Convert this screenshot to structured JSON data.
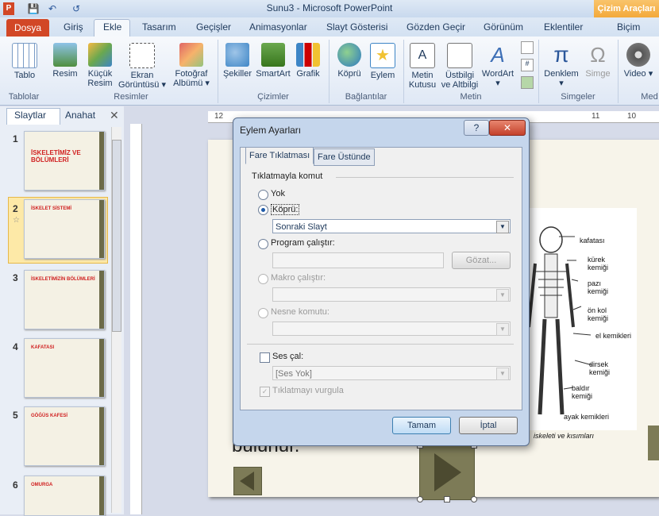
{
  "window": {
    "title": "Sunu3 - Microsoft PowerPoint",
    "contextual_title": "Çizim Araçları"
  },
  "qat": {
    "save_icon": "save-icon",
    "undo_icon": "undo-icon",
    "redo_icon": "redo-icon"
  },
  "tabs": [
    {
      "label": "Dosya"
    },
    {
      "label": "Giriş"
    },
    {
      "label": "Ekle"
    },
    {
      "label": "Tasarım"
    },
    {
      "label": "Geçişler"
    },
    {
      "label": "Animasyonlar"
    },
    {
      "label": "Slayt Gösterisi"
    },
    {
      "label": "Gözden Geçir"
    },
    {
      "label": "Görünüm"
    },
    {
      "label": "Eklentiler"
    },
    {
      "label": "Biçim"
    }
  ],
  "ribbon": {
    "tablo": "Tablo",
    "resim": "Resim",
    "kucuk_resim_1": "Küçük",
    "kucuk_resim_2": "Resim",
    "ekran_1": "Ekran",
    "ekran_2": "Görüntüsü",
    "foto_1": "Fotoğraf",
    "foto_2": "Albümü",
    "sekiller": "Şekiller",
    "smartart": "SmartArt",
    "grafik": "Grafik",
    "kopru": "Köprü",
    "eylem": "Eylem",
    "metin_1": "Metin",
    "metin_2": "Kutusu",
    "ustbilgi_1": "Üstbilgi",
    "ustbilgi_2": "ve Altbilgi",
    "wordart": "WordArt",
    "denklem": "Denklem",
    "simge": "Simge",
    "video": "Video",
    "groups": {
      "tablolar": "Tablolar",
      "resimler": "Resimler",
      "cizimler": "Çizimler",
      "baglantilar": "Bağlantılar",
      "metin": "Metin",
      "simgeler": "Simgeler",
      "medya": "Med"
    }
  },
  "panel": {
    "tab_slides": "Slaytlar",
    "tab_outline": "Anahat"
  },
  "slides": [
    {
      "num": "1",
      "title": "İSKELETİMİZ VE BÖLÜMLERİ"
    },
    {
      "num": "2",
      "title": "İSKELET SİSTEMİ"
    },
    {
      "num": "3",
      "title": "İSKELETİMİZİN BÖLÜMLERİ"
    },
    {
      "num": "4",
      "title": "KAFATASI"
    },
    {
      "num": "5",
      "title": "GÖĞÜS KAFESİ"
    },
    {
      "num": "6",
      "title": "OMURGA"
    }
  ],
  "ruler": {
    "h_labels": [
      "12",
      "11",
      "10"
    ]
  },
  "slide_content": {
    "body_fragment": "bulunur.",
    "labels": [
      "kafatası",
      "kürek kemiği",
      "pazı kemiği",
      "ön kol kemiği",
      "el kemikleri",
      "dirsek kemiği",
      "baldır kemiği",
      "ayak kemikleri"
    ],
    "caption": "iskeleti ve kısımları"
  },
  "dialog": {
    "title": "Eylem Ayarları",
    "tab1": "Fare Tıklatması",
    "tab2": "Fare Üstünde",
    "group_label": "Tıklatmayla komut",
    "opt_none": "Yok",
    "opt_link": "Köprü:",
    "link_value": "Sonraki Slayt",
    "opt_program": "Program çalıştır:",
    "browse": "Gözat...",
    "opt_macro": "Makro çalıştır:",
    "opt_object": "Nesne komutu:",
    "sound_label": "Ses çal:",
    "sound_value": "[Ses Yok]",
    "highlight": "Tıklatmayı vurgula",
    "ok": "Tamam",
    "cancel": "İptal",
    "help": "?",
    "close": "✕"
  }
}
